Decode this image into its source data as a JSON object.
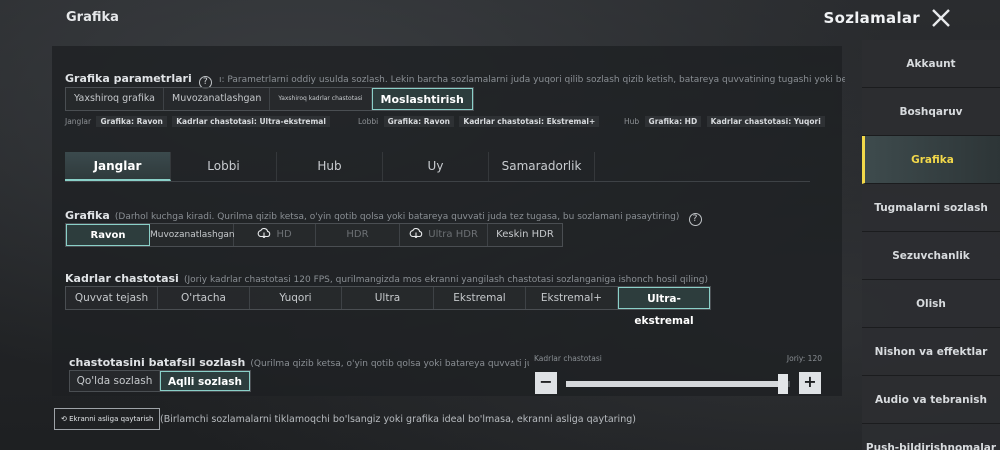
{
  "header": {
    "section_title": "Grafika",
    "title": "Sozlamalar",
    "close_icon": "close-icon"
  },
  "graphics_params": {
    "label": "Grafika parametrlari",
    "desc": "ı: Parametrlarni oddiy usulda sozlash. Lekin barcha sozlamalarni juda yuqori qilib sozlash qizib ketish, batareya quvvatining tugashi yoki beqaror geymple",
    "options": [
      "Yaxshiroq grafika",
      "Muvozanatlashgan",
      "Yaxshiroq kadrlar chastotasi",
      "Moslashtirish"
    ],
    "selected": "Moslashtirish"
  },
  "presets_info": {
    "match": {
      "label": "Janglar",
      "tags": [
        "Grafika: Ravon",
        "Kadrlar chastotasi: Ultra-ekstremal"
      ]
    },
    "lobby": {
      "label": "Lobbi",
      "tags": [
        "Grafika: Ravon",
        "Kadrlar chastotasi: Ekstremal+"
      ]
    },
    "hub": {
      "label": "Hub",
      "tags": [
        "Grafika: HD",
        "Kadrlar chastotasi: Yuqori"
      ]
    }
  },
  "tabs": [
    "Janglar",
    "Lobbi",
    "Hub",
    "Uy",
    "Samaradorlik"
  ],
  "active_tab": "Janglar",
  "graphics": {
    "label": "Grafika",
    "desc": "(Darhol kuchga kiradi. Qurilma qizib ketsa, o'yin qotib qolsa yoki batareya quvvati juda tez tugasa, bu sozlamani pasaytiring)",
    "options": [
      "Ravon",
      "Muvozanatlashgan",
      "HD",
      "HDR",
      "Ultra HDR",
      "Keskin HDR"
    ],
    "selected": "Ravon"
  },
  "frame_rate": {
    "label": "Kadrlar chastotasi",
    "desc": "(Joriy kadrlar chastotasi 120 FPS, qurilmangizda mos ekranni yangilash chastotasi sozlanganiga ishonch hosil qiling)",
    "options": [
      "Quvvat tejash",
      "O'rtacha",
      "Yuqori",
      "Ultra",
      "Ekstremal",
      "Ekstremal+",
      "Ultra-ekstremal"
    ],
    "selected": "Ultra-ekstremal"
  },
  "detail": {
    "label": "chastotasini batafsil sozlash",
    "desc": "(Qurilma qizib ketsa, o'yin qotib qolsa yoki batareya quvvati juda tez tugasa, t",
    "options": [
      "Qo'lda sozlash",
      "Aqlli sozlash"
    ],
    "selected": "Aqlli sozlash",
    "slider_label": "Kadrlar chastotasi",
    "slider_value_text": "Joriy: 120",
    "slider_fraction": 0.97,
    "minus": "−",
    "plus": "+"
  },
  "reset": {
    "button_label": "Ekranni asliga qaytarish",
    "desc": "(Birlamchi sozlamalarni tiklamoqchi bo'lsangiz yoki grafika ideal bo'lmasa, ekranni asliga qaytaring)"
  },
  "sidebar": {
    "items": [
      "Akkaunt",
      "Boshqaruv",
      "Grafika",
      "Tugmalarni sozlash",
      "Sezuvchanlik",
      "Olish",
      "Nishon va effektlar",
      "Audio va tebranish",
      "Push-bildirishnomalar"
    ],
    "active": "Grafika"
  },
  "colors": {
    "accent": "#8ad0c8",
    "active_sidebar": "#f2d84a"
  }
}
